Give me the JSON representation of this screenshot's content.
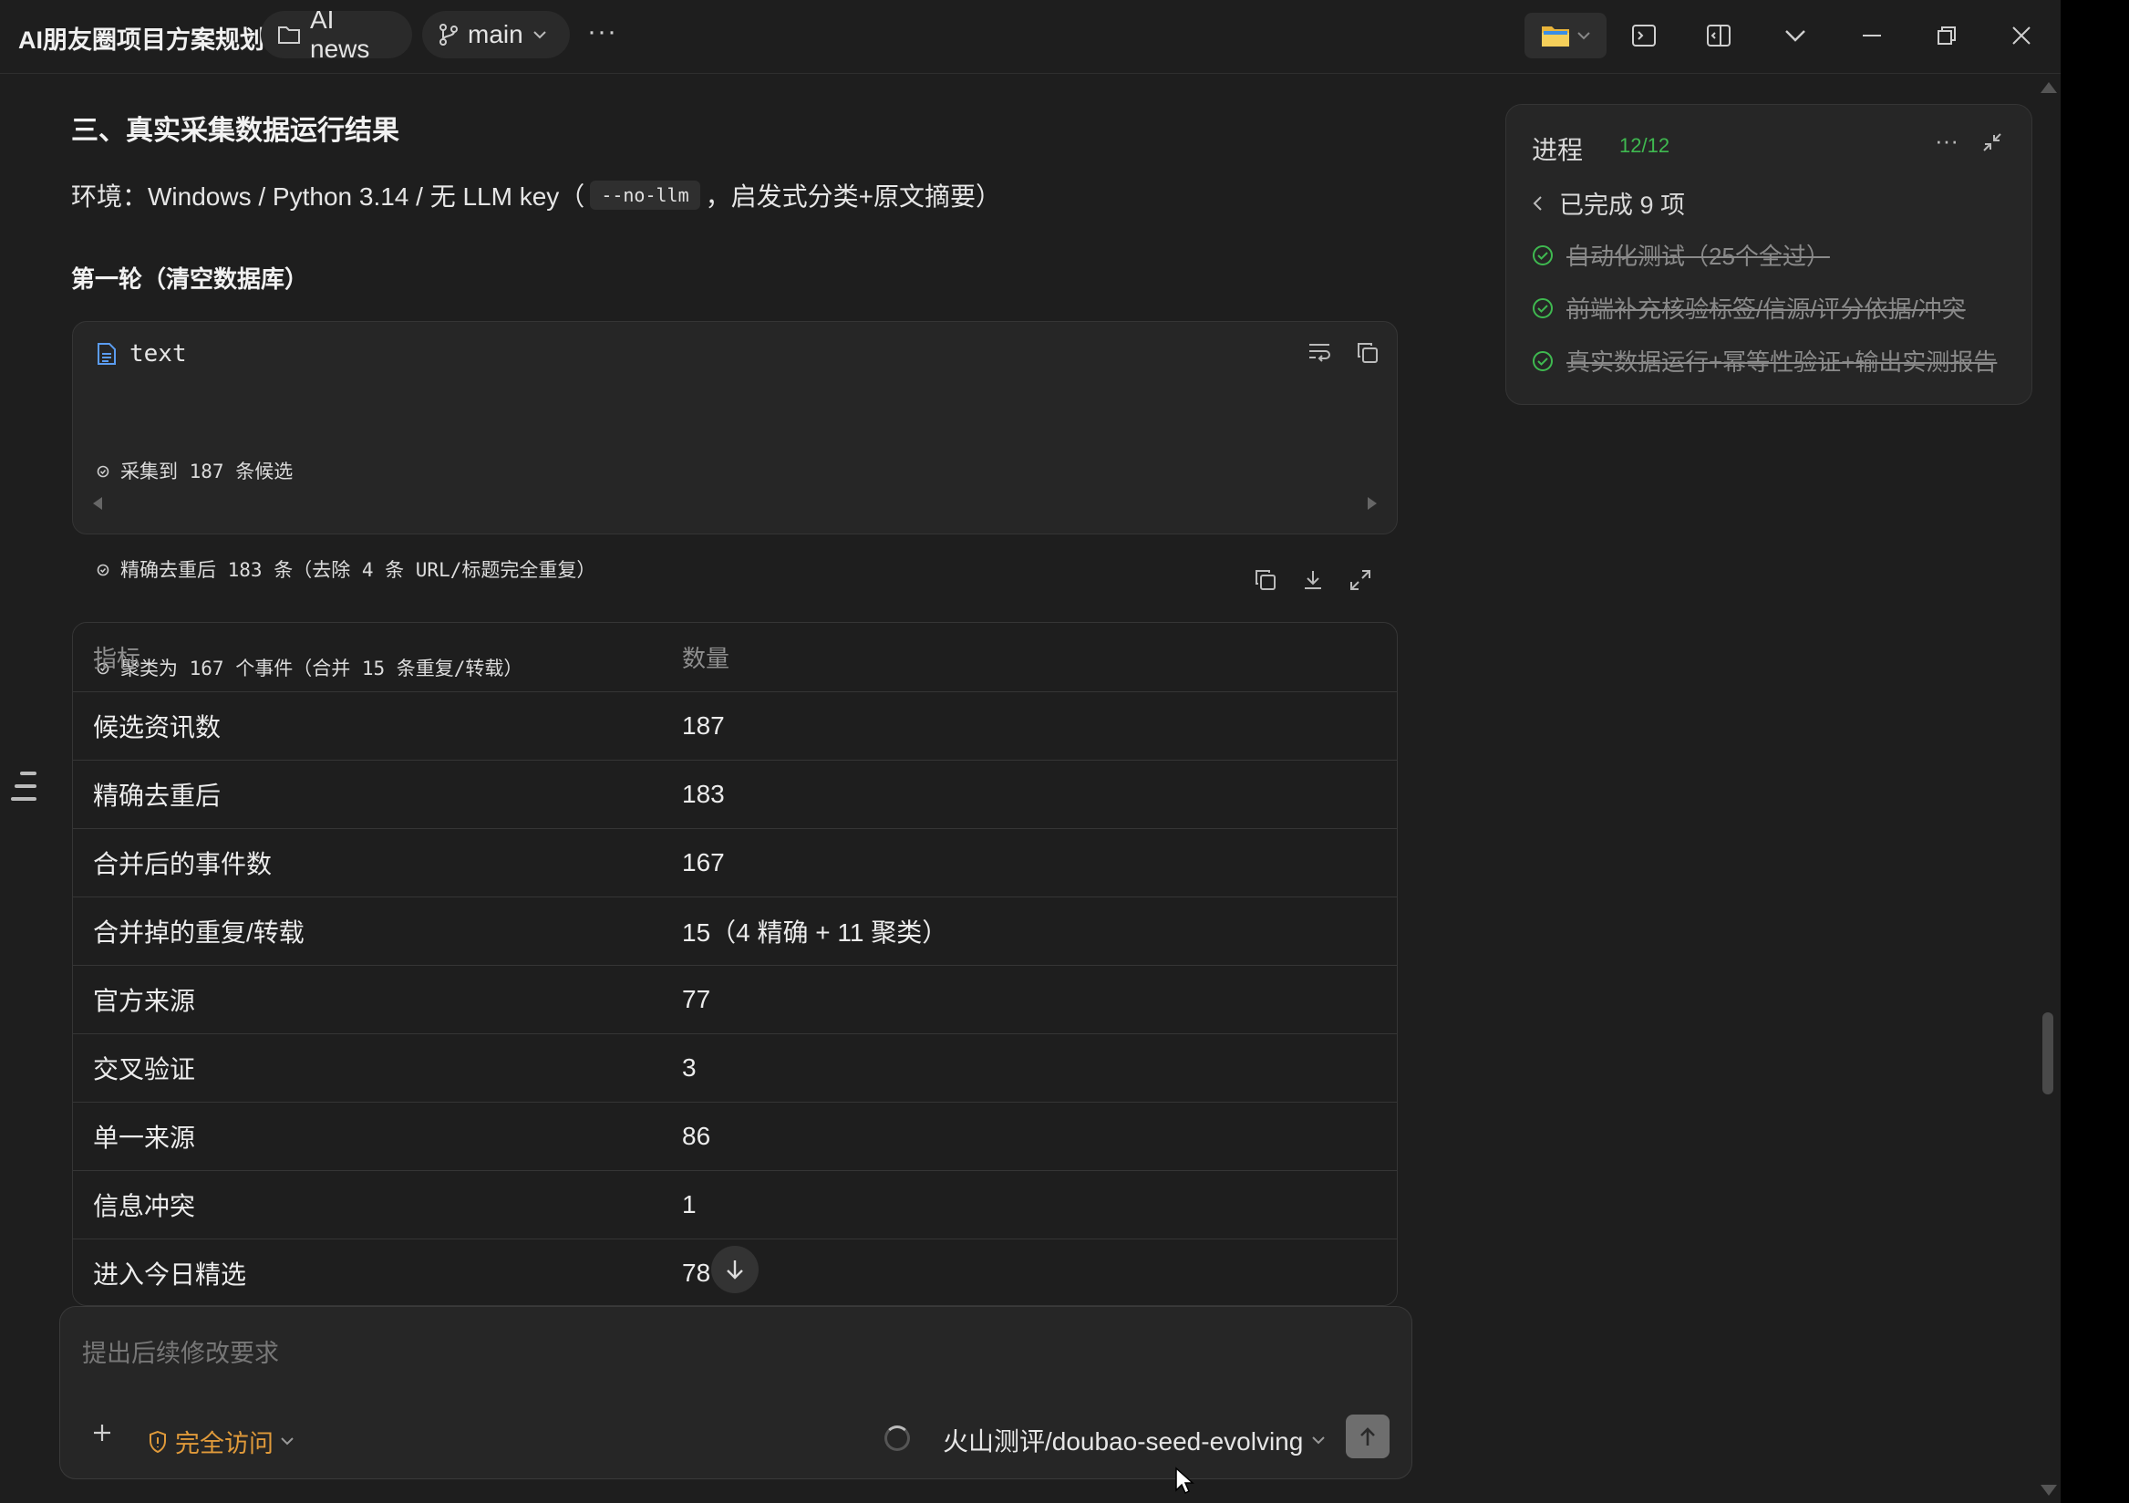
{
  "titlebar": {
    "app_title": "AI朋友圈项目方案规划",
    "project_label": "AI news",
    "branch_label": "main",
    "more": "···",
    "icons": [
      "folder-icon",
      "terminal-icon",
      "split-panel-icon",
      "chevron-down-icon",
      "minimize-icon",
      "restore-icon",
      "close-icon"
    ]
  },
  "content": {
    "section_title": "三、真实采集数据运行结果",
    "env_prefix": "环境：Windows / Python 3.14 / 无 LLM key（",
    "env_code": "--no-llm",
    "env_suffix": "，启发式分类+原文摘要）",
    "round_title": "第一轮（清空数据库）"
  },
  "code_block": {
    "language": "text",
    "lines": [
      "采集到 187 条候选",
      "精确去重后 183 条（去除 4 条 URL/标题完全重复）",
      "聚类为 167 个事件（合并 15 条重复/转载）"
    ]
  },
  "table": {
    "headers": [
      "指标",
      "数量"
    ],
    "rows": [
      [
        "候选资讯数",
        "187"
      ],
      [
        "精确去重后",
        "183"
      ],
      [
        "合并后的事件数",
        "167"
      ],
      [
        "合并掉的重复/转载",
        "15（4 精确 + 11 聚类）"
      ],
      [
        "官方来源",
        "77"
      ],
      [
        "交叉验证",
        "3"
      ],
      [
        "单一来源",
        "86"
      ],
      [
        "信息冲突",
        "1"
      ],
      [
        "进入今日精选",
        "78"
      ]
    ]
  },
  "composer": {
    "placeholder": "提出后续修改要求",
    "access_label": "完全访问",
    "model_label": "火山测评/doubao-seed-evolving"
  },
  "progress": {
    "title": "进程",
    "count": "12/12",
    "done_label": "已完成 9 项",
    "items": [
      "自动化测试（25个全过）",
      "前端补充核验标签/信源/评分依据/冲突",
      "真实数据运行+幂等性验证+输出实测报告"
    ]
  },
  "colors": {
    "background": "#1e1e1e",
    "panel": "#262626",
    "success": "#3fb950",
    "warning": "#e09a3a"
  }
}
